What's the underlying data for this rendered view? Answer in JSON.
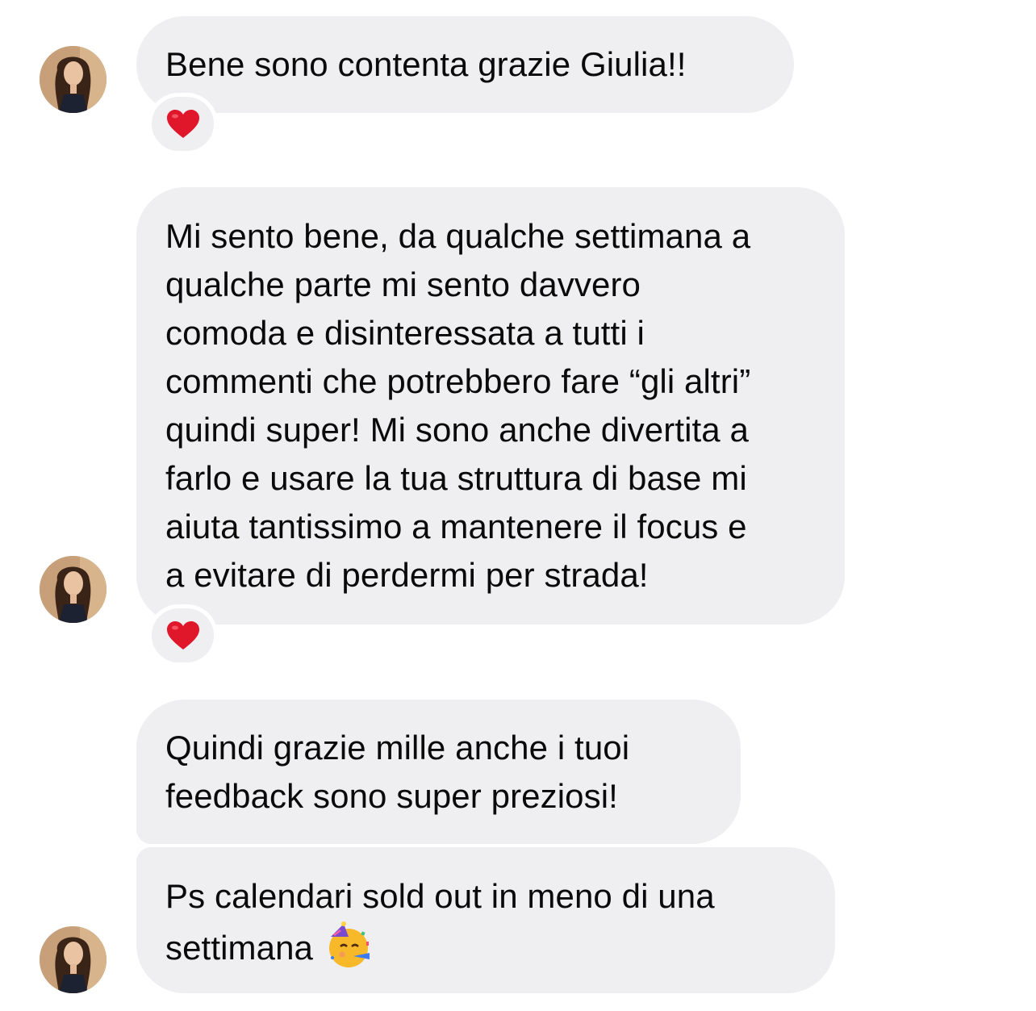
{
  "conversation": {
    "messages": [
      {
        "id": "m1",
        "lines": [
          "Bene sono contenta grazie Giulia!!"
        ],
        "reaction": "heart"
      },
      {
        "id": "m2",
        "lines": [
          "Mi sento bene, da qualche settimana a",
          "qualche parte mi sento davvero",
          "comoda e disinteressata a tutti i",
          "commenti che potrebbero fare “gli altri”",
          "quindi super! Mi sono anche divertita a",
          "farlo e usare la tua struttura di base mi",
          "aiuta tantissimo a mantenere il focus e",
          "a evitare di perdermi per strada!"
        ],
        "reaction": "heart"
      },
      {
        "id": "m3",
        "lines": [
          "Quindi grazie mille anche i tuoi",
          "feedback sono super preziosi!"
        ]
      },
      {
        "id": "m4",
        "lines": [
          "Ps calendari sold out in meno di una",
          "settimana"
        ],
        "trailing_emoji": "partying-face"
      }
    ]
  },
  "colors": {
    "bubble_background": "#efeff1",
    "heart": "#e0162b",
    "text": "#0a0a0a"
  }
}
